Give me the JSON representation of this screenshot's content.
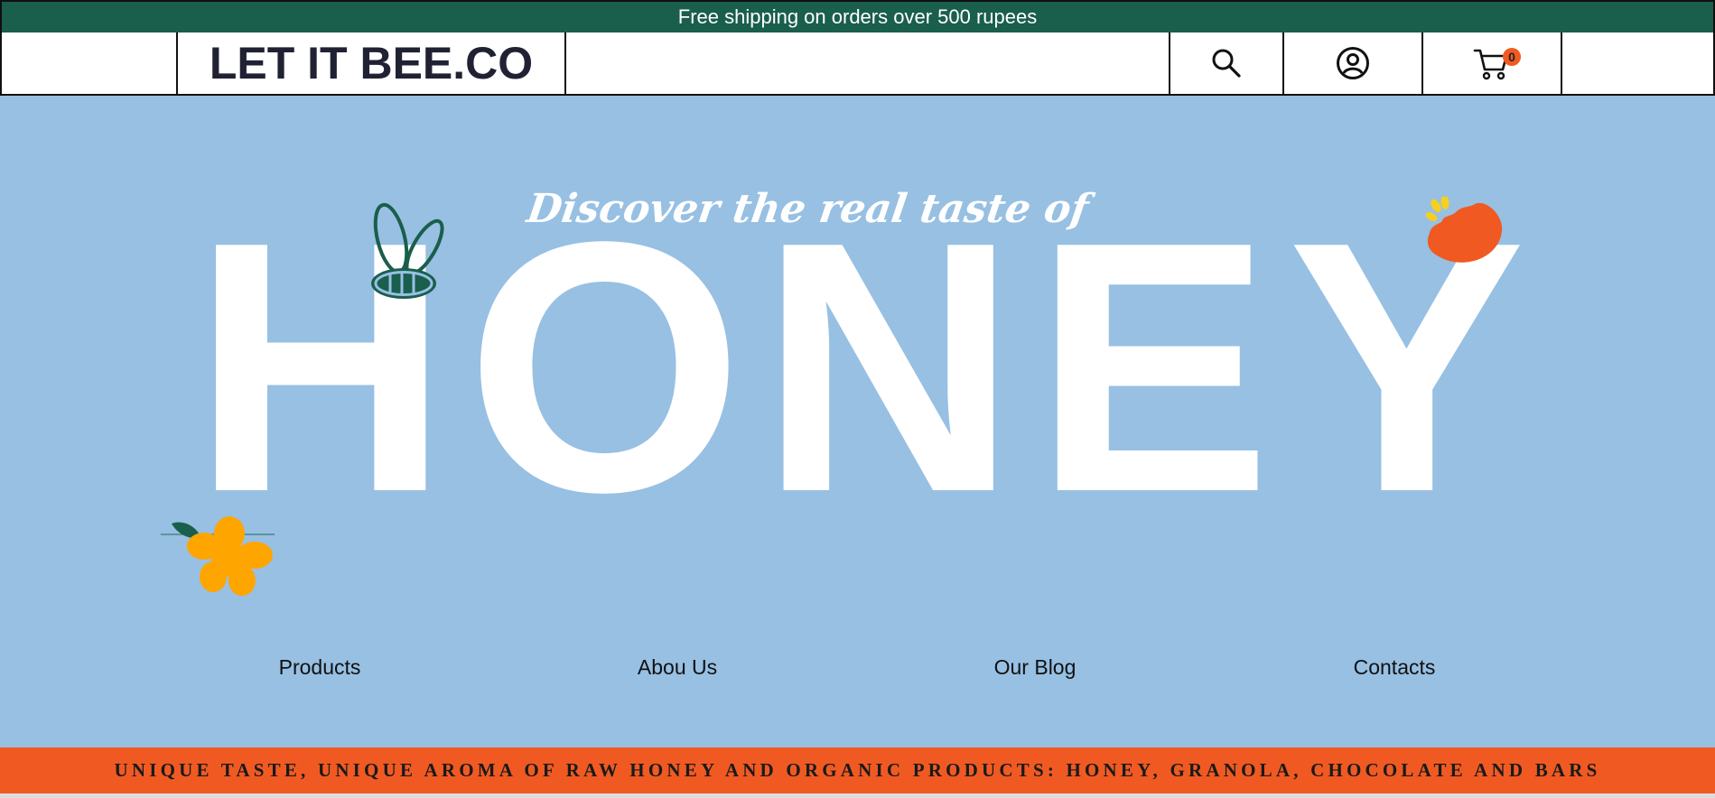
{
  "announcement": {
    "text": "Free shipping on orders over 500 rupees"
  },
  "header": {
    "logo": "LET IT BEE.CO",
    "icons": {
      "search": "search-icon",
      "account": "user-circle-icon",
      "cart": "cart-icon"
    },
    "cart_count": "0"
  },
  "hero": {
    "tagline": "Discover the real taste of",
    "headline": "HONEY"
  },
  "nav": {
    "items": [
      {
        "label": "Products"
      },
      {
        "label": "Abou Us"
      },
      {
        "label": "Our Blog"
      },
      {
        "label": "Contacts"
      }
    ]
  },
  "ribbon": {
    "text": "UNIQUE TASTE, UNIQUE AROMA OF RAW HONEY AND ORGANIC PRODUCTS: HONEY, GRANOLA, CHOCOLATE AND BARS"
  },
  "colors": {
    "topbar": "#1a5e4c",
    "hero_bg": "#97c0e3",
    "accent_orange": "#f05a22",
    "flower_yellow": "#ffa500",
    "leaf_green": "#1a5e4c"
  }
}
